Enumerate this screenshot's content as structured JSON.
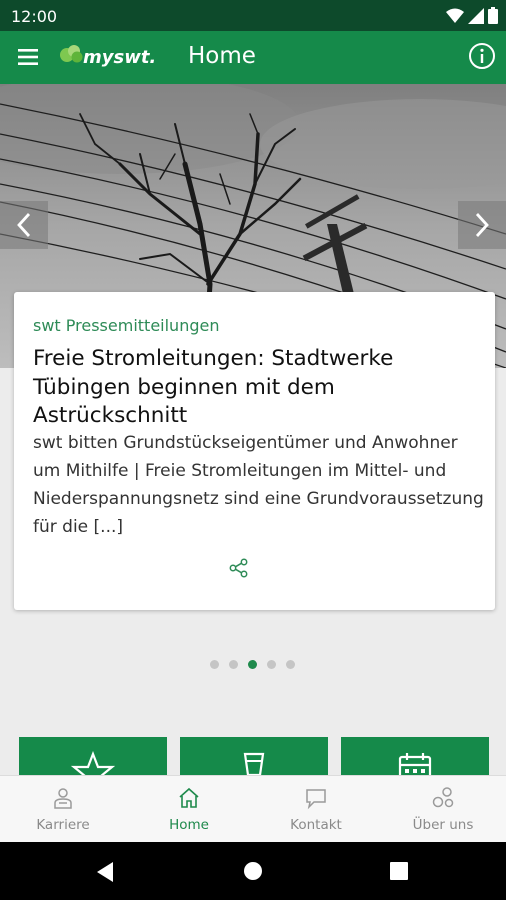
{
  "status_bar": {
    "time": "12:00"
  },
  "app_bar": {
    "title": "Home",
    "logo_text": "myswt."
  },
  "colors": {
    "brand_green": "#158a4a",
    "dark_green": "#0d4a2b",
    "accent_text": "#2e8b57"
  },
  "article": {
    "category": "swt Pressemitteilungen",
    "title": "Freie Stromleitungen: Stadtwerke Tübingen beginnen mit dem Astrückschnitt",
    "excerpt": "swt bitten Grundstückseigentümer und Anwohner um Mithilfe | Freie Stromleitungen im Mittel- und Niederspannungsnetz sind eine Grundvoraussetzung für die [...]"
  },
  "carousel": {
    "slide_count": 5,
    "active_index": 2
  },
  "tiles": [
    {
      "icon": "star-icon"
    },
    {
      "icon": "cup-icon"
    },
    {
      "icon": "calendar-icon"
    }
  ],
  "bottom_nav": {
    "items": [
      {
        "label": "Karriere",
        "icon": "person-icon"
      },
      {
        "label": "Home",
        "icon": "home-icon"
      },
      {
        "label": "Kontakt",
        "icon": "chat-icon"
      },
      {
        "label": "Über uns",
        "icon": "people-icon"
      }
    ],
    "active": "Home"
  }
}
